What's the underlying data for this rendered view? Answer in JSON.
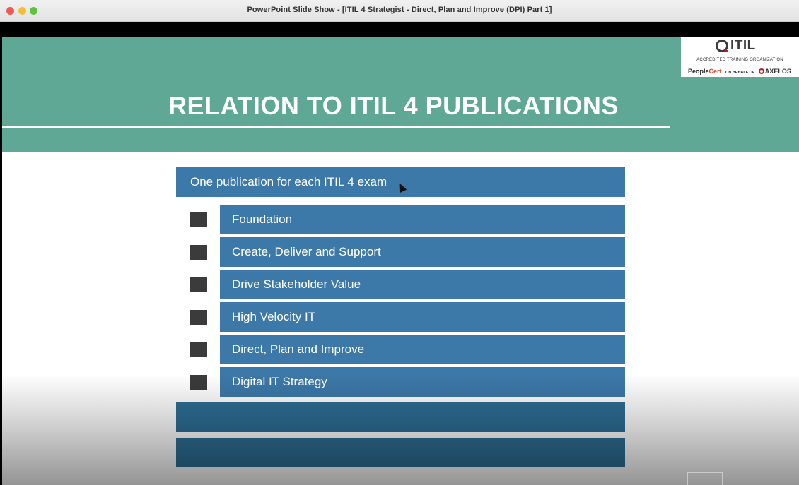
{
  "window": {
    "title": "PowerPoint Slide Show - [ITIL 4 Strategist - Direct, Plan and Improve (DPI) Part 1]"
  },
  "slide": {
    "title": "RELATION TO ITIL 4 PUBLICATIONS",
    "main_box": "One publication for each ITIL 4 exam",
    "items": [
      {
        "label": "Foundation"
      },
      {
        "label": "Create, Deliver and Support"
      },
      {
        "label": "Drive Stakeholder Value"
      },
      {
        "label": "High Velocity IT"
      },
      {
        "label": "Direct, Plan and Improve"
      },
      {
        "label": "Digital IT Strategy"
      }
    ]
  },
  "logo": {
    "brand": "ITIL",
    "subtitle": "ACCREDITED TRAINING ORGANIZATION",
    "partner_a": "People",
    "partner_b": "Cert",
    "on_behalf": "ON BEHALF OF",
    "partner_c": "AXELOS"
  },
  "colors": {
    "header_teal": "#5fa895",
    "box_blue": "#3c78a8",
    "square_dark": "#3b3b3b"
  }
}
